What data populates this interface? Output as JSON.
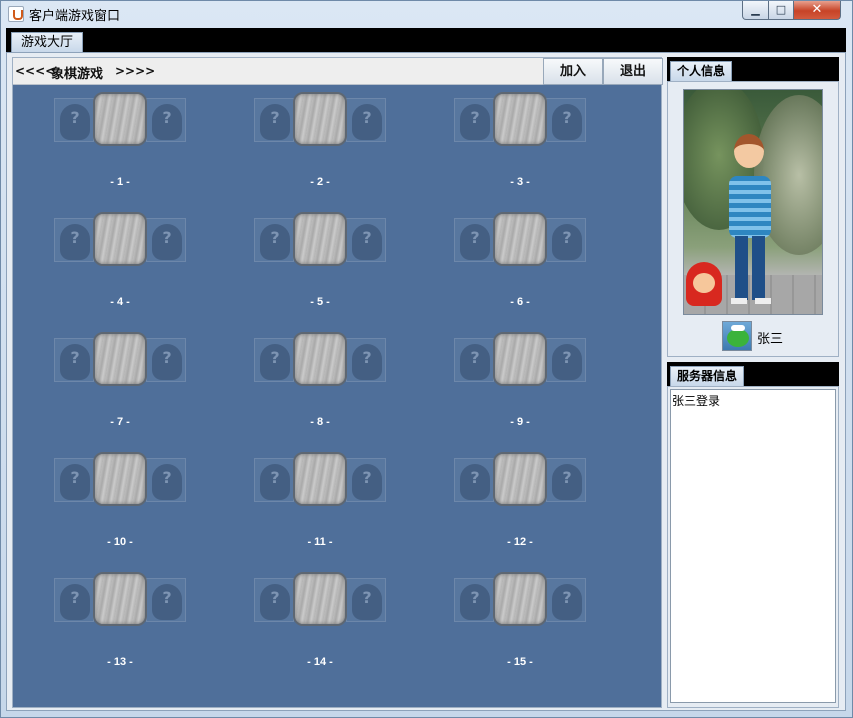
{
  "window": {
    "title": "客户端游戏窗口",
    "controls": {
      "minimize": "▁",
      "maximize": "□",
      "close": "✕"
    }
  },
  "main_tab": {
    "label": "游戏大厅"
  },
  "nav": {
    "prev": "<<<<",
    "title": "象棋游戏",
    "next": ">>>>",
    "join_button": "加入",
    "exit_button": "退出"
  },
  "seat_placeholder": "?",
  "tables": [
    {
      "label": "- 1 -"
    },
    {
      "label": "- 2 -"
    },
    {
      "label": "- 3 -"
    },
    {
      "label": "- 4 -"
    },
    {
      "label": "- 5 -"
    },
    {
      "label": "- 6 -"
    },
    {
      "label": "- 7 -"
    },
    {
      "label": "- 8 -"
    },
    {
      "label": "- 9 -"
    },
    {
      "label": "- 10 -"
    },
    {
      "label": "- 11 -"
    },
    {
      "label": "- 12 -"
    },
    {
      "label": "- 13 -"
    },
    {
      "label": "- 14 -"
    },
    {
      "label": "- 15 -"
    }
  ],
  "profile": {
    "tab_label": "个人信息",
    "user_name": "张三"
  },
  "server": {
    "tab_label": "服务器信息",
    "log": "张三登录"
  },
  "colors": {
    "game_area_bg": "#4f6f9a",
    "panel_bg": "#e6ecf3",
    "close_button": "#c74327"
  }
}
